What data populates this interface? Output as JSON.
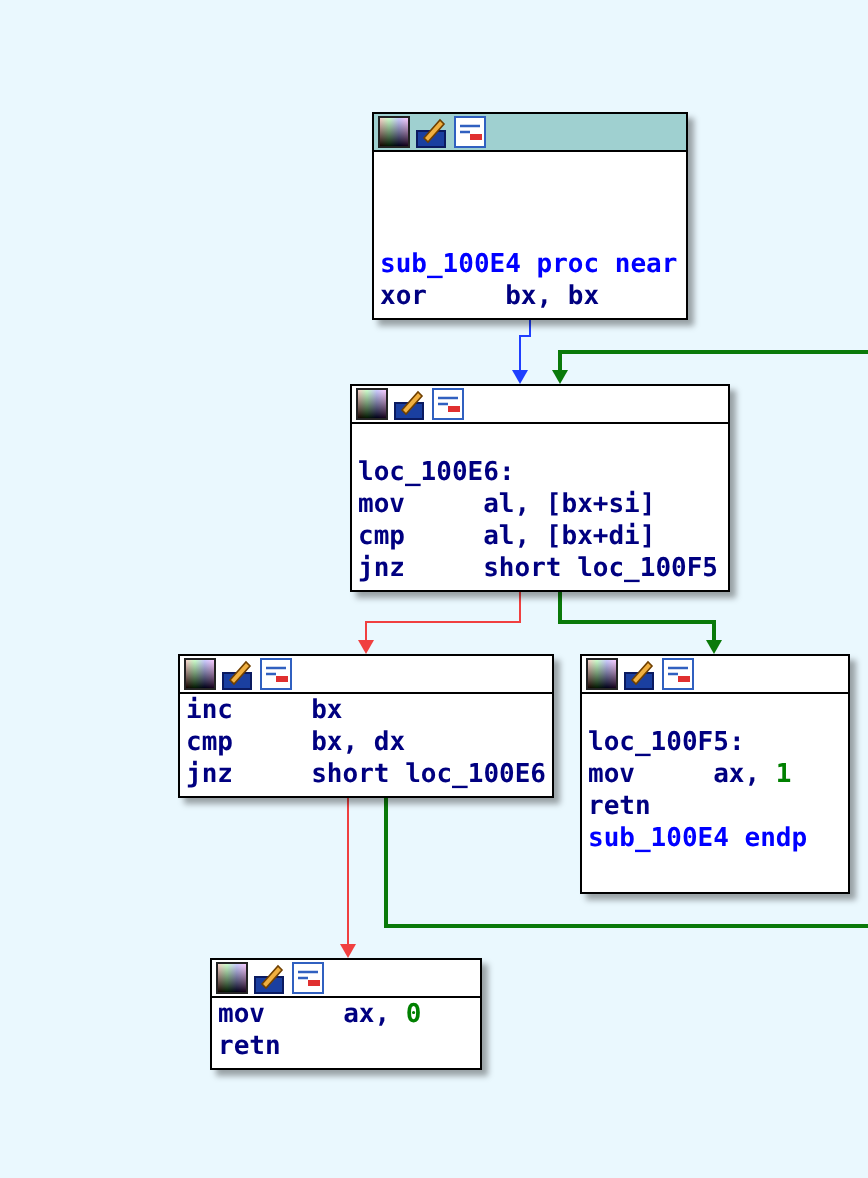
{
  "nodes": [
    {
      "selected": true,
      "lines": [
        {
          "kind": "blank"
        },
        {
          "kind": "blank"
        },
        {
          "kind": "blank"
        },
        {
          "kind": "proc",
          "text": "sub_100E4 proc near"
        },
        {
          "kind": "instr",
          "mnemonic": "xor",
          "operands": [
            {
              "kind": "reg",
              "text": "bx, bx"
            }
          ]
        }
      ]
    },
    {
      "selected": false,
      "lines": [
        {
          "kind": "blank"
        },
        {
          "kind": "label",
          "text": "loc_100E6:"
        },
        {
          "kind": "instr",
          "mnemonic": "mov",
          "operands": [
            {
              "kind": "reg",
              "text": "al, [bx+si]"
            }
          ]
        },
        {
          "kind": "instr",
          "mnemonic": "cmp",
          "operands": [
            {
              "kind": "reg",
              "text": "al, [bx+di]"
            }
          ]
        },
        {
          "kind": "instr",
          "mnemonic": "jnz",
          "operands": [
            {
              "kind": "reg",
              "text": "short loc_100F5"
            }
          ]
        }
      ]
    },
    {
      "selected": false,
      "lines": [
        {
          "kind": "instr",
          "mnemonic": "inc",
          "operands": [
            {
              "kind": "reg",
              "text": "bx"
            }
          ]
        },
        {
          "kind": "instr",
          "mnemonic": "cmp",
          "operands": [
            {
              "kind": "reg",
              "text": "bx, dx"
            }
          ]
        },
        {
          "kind": "instr",
          "mnemonic": "jnz",
          "operands": [
            {
              "kind": "reg",
              "text": "short loc_100E6"
            }
          ]
        }
      ]
    },
    {
      "selected": false,
      "lines": [
        {
          "kind": "blank"
        },
        {
          "kind": "label",
          "text": "loc_100F5:"
        },
        {
          "kind": "instr",
          "mnemonic": "mov",
          "operands": [
            {
              "kind": "reg",
              "text": "ax, "
            },
            {
              "kind": "num",
              "text": "1"
            }
          ]
        },
        {
          "kind": "instr",
          "mnemonic": "retn"
        },
        {
          "kind": "proc",
          "text": "sub_100E4 endp"
        },
        {
          "kind": "blank"
        }
      ]
    },
    {
      "selected": false,
      "lines": [
        {
          "kind": "instr",
          "mnemonic": "mov",
          "operands": [
            {
              "kind": "reg",
              "text": "ax, "
            },
            {
              "kind": "num",
              "text": "0"
            }
          ]
        },
        {
          "kind": "instr",
          "mnemonic": "retn"
        }
      ]
    }
  ],
  "edges": [
    {
      "kind": "normal"
    },
    {
      "kind": "fallthrough"
    },
    {
      "kind": "jump"
    },
    {
      "kind": "fallthrough"
    },
    {
      "kind": "jump"
    }
  ]
}
